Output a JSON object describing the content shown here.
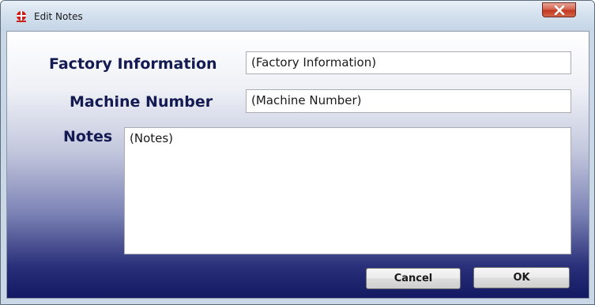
{
  "window": {
    "title": "Edit Notes",
    "app_icon": "app-logo-icon",
    "close_icon": "close-icon"
  },
  "form": {
    "factory_label": "Factory Information",
    "factory_value": "(Factory Information)",
    "machine_label": "Machine Number",
    "machine_value": "(Machine Number)",
    "notes_label": "Notes",
    "notes_value": "(Notes)"
  },
  "buttons": {
    "cancel_label": "Cancel",
    "ok_label": "OK"
  },
  "colors": {
    "label_text": "#141a52",
    "gradient_bottom": "#121a62",
    "close_button": "#c2381f",
    "app_icon": "#cc1f1a"
  }
}
